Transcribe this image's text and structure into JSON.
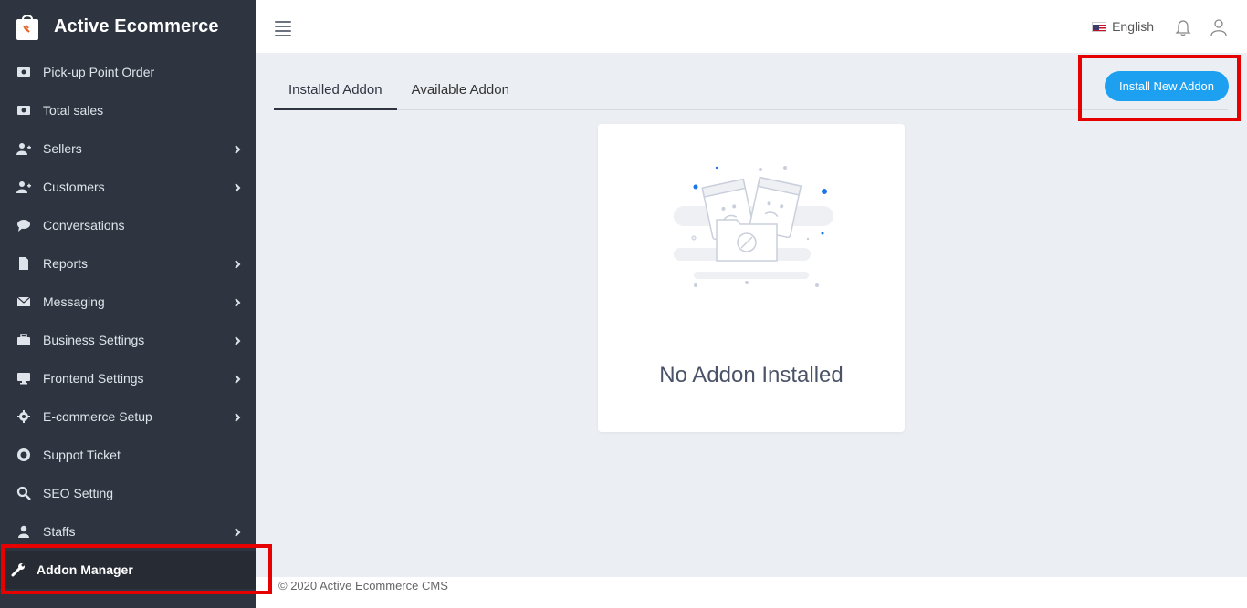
{
  "brand": {
    "title": "Active Ecommerce"
  },
  "sidebar": {
    "items": [
      {
        "label": "Pick-up Point Order",
        "icon": "money-icon",
        "chevron": false
      },
      {
        "label": "Total sales",
        "icon": "money-icon",
        "chevron": false
      },
      {
        "label": "Sellers",
        "icon": "user-plus-icon",
        "chevron": true
      },
      {
        "label": "Customers",
        "icon": "user-plus-icon",
        "chevron": true
      },
      {
        "label": "Conversations",
        "icon": "chat-bubble-icon",
        "chevron": false
      },
      {
        "label": "Reports",
        "icon": "file-icon",
        "chevron": true
      },
      {
        "label": "Messaging",
        "icon": "envelope-icon",
        "chevron": true
      },
      {
        "label": "Business Settings",
        "icon": "briefcase-icon",
        "chevron": true
      },
      {
        "label": "Frontend Settings",
        "icon": "monitor-icon",
        "chevron": true
      },
      {
        "label": "E-commerce Setup",
        "icon": "gear-icon",
        "chevron": true
      },
      {
        "label": "Suppot Ticket",
        "icon": "lifebuoy-icon",
        "chevron": false
      },
      {
        "label": "SEO Setting",
        "icon": "search-icon",
        "chevron": false
      },
      {
        "label": "Staffs",
        "icon": "user-icon",
        "chevron": true
      },
      {
        "label": "Addon Manager",
        "icon": "wrench-icon",
        "chevron": false,
        "active": true
      }
    ]
  },
  "topbar": {
    "language": "English"
  },
  "tabs": [
    {
      "label": "Installed Addon",
      "active": true
    },
    {
      "label": "Available Addon",
      "active": false
    }
  ],
  "actions": {
    "install_label": "Install New Addon"
  },
  "empty_state": {
    "message": "No Addon Installed"
  },
  "footer": {
    "text": "© 2020 Active Ecommerce CMS"
  },
  "colors": {
    "sidebar": "#2f3540",
    "accent": "#1ea0f1",
    "highlight": "#e60000",
    "background": "#ebeef3"
  }
}
